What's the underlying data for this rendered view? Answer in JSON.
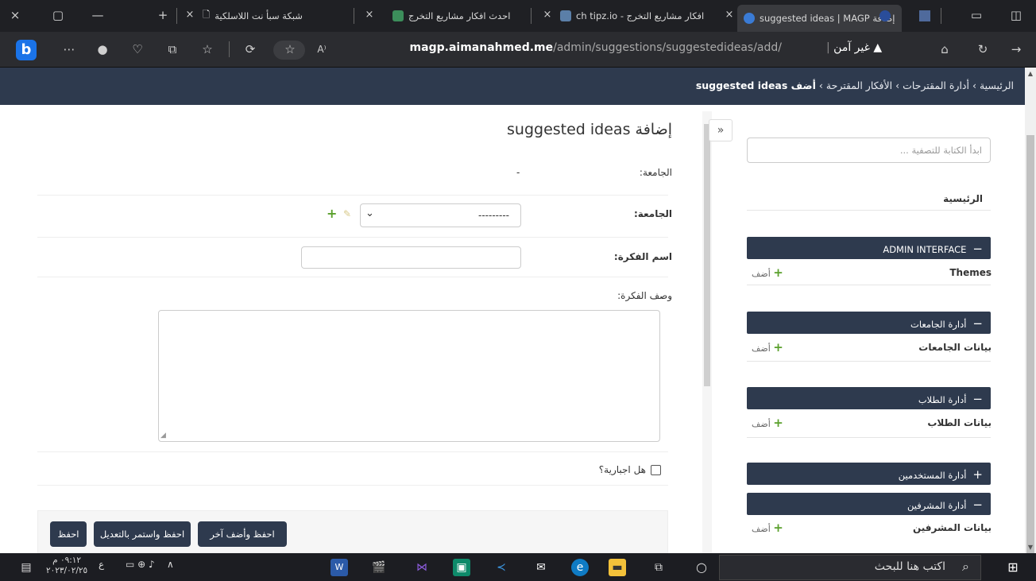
{
  "browser": {
    "tabs": [
      {
        "title": "شبكة سبأ نت اللاسلكية",
        "close": "×"
      },
      {
        "title": "احدث افكار مشاريع التخرج",
        "close": "×"
      },
      {
        "title": "افكار مشاريع التخرج - ch tipz.io",
        "close": "×"
      },
      {
        "title": "إضافة suggested ideas | MAGP",
        "close": "×"
      }
    ],
    "new_tab": "+",
    "url_host": "magp.aimanahmed.me",
    "url_path": "/admin/suggestions/suggestedideas/add/",
    "insecure_label": "غير آمن"
  },
  "page": {
    "breadcrumb": {
      "home": "الرئيسية",
      "app": "أدارة المقترحات",
      "model": "الأفكار المقترحة",
      "current": "أضف suggested ideas",
      "sep": "›"
    },
    "collapse": "»",
    "form": {
      "title": "إضافة suggested ideas",
      "readonly_label": "الجامعة:",
      "readonly_value": "-",
      "university_label": "الجامعة:",
      "university_selected": "---------",
      "idea_name_label": "اسم الفكرة:",
      "idea_desc_label": "وصف الفكرة:",
      "mandatory_label": "هل اجبارية؟",
      "buttons": {
        "save_add_another": "احفظ وأضف آخر",
        "save_continue": "احفظ واستمر بالتعديل",
        "save": "احفظ"
      }
    },
    "sidebar": {
      "filter_placeholder": "ابدأ الكتابة للتصفية ...",
      "home": "الرئيسية",
      "add_label": "أضف",
      "groups": [
        {
          "title": "ADMIN INTERFACE",
          "state": "−",
          "models": [
            "Themes"
          ]
        },
        {
          "title": "أدارة الجامعات",
          "state": "−",
          "models": [
            "بيانات الجامعات"
          ]
        },
        {
          "title": "أدارة الطلاب",
          "state": "−",
          "models": [
            "بيانات الطلاب"
          ]
        },
        {
          "title": "أدارة المستخدمين",
          "state": "+",
          "models": []
        },
        {
          "title": "أدارة المشرفين",
          "state": "−",
          "models": [
            "بيانات المشرفين"
          ]
        }
      ]
    }
  },
  "taskbar": {
    "search_placeholder": "اكتب هنا للبحث",
    "time": "٠٩:١٢ م",
    "date": "٢٠٢٣/٠٢/٢٥",
    "lang": "ع"
  },
  "colors": {
    "admin_header": "#2e3a4e",
    "add_green": "#5aa02c"
  }
}
